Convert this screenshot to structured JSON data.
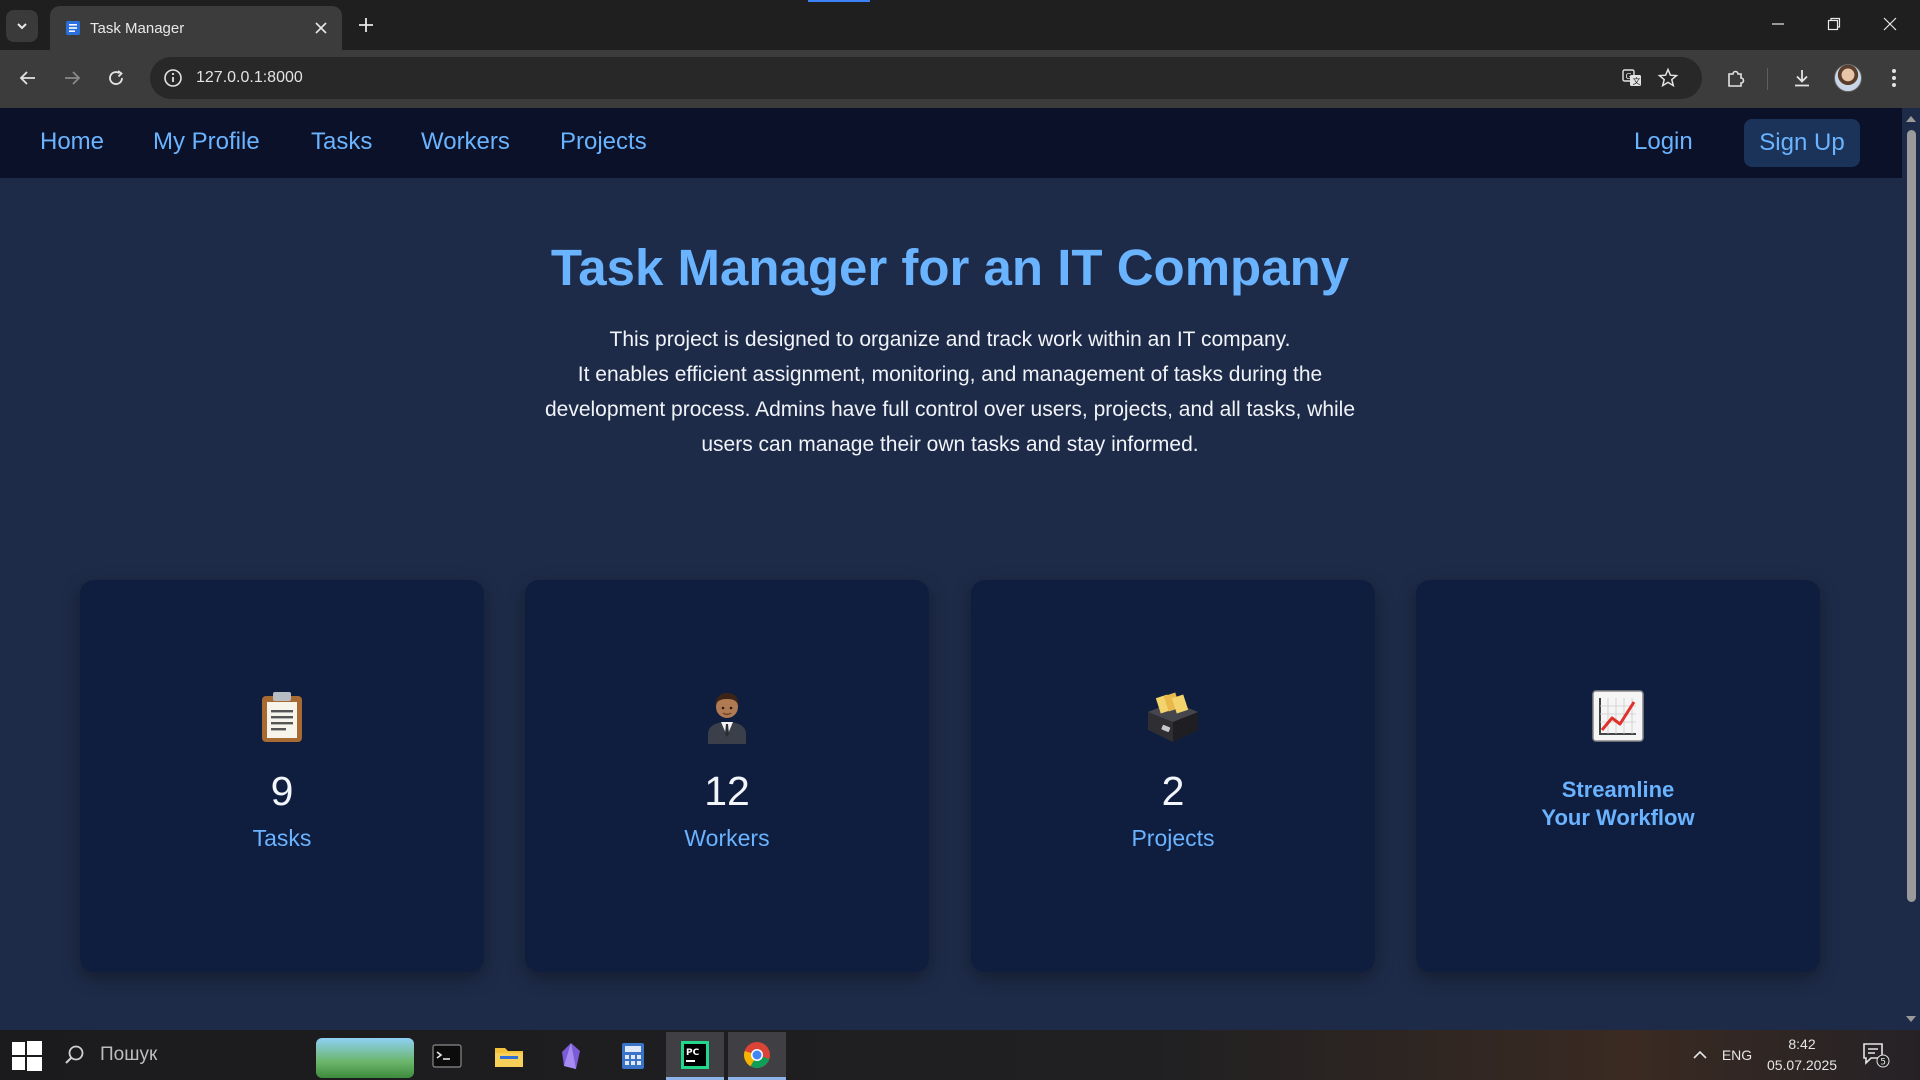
{
  "browser": {
    "tab_title": "Task Manager",
    "url": "127.0.0.1:8000"
  },
  "nav": {
    "links": [
      "Home",
      "My Profile",
      "Tasks",
      "Workers",
      "Projects"
    ],
    "login": "Login",
    "signup": "Sign Up"
  },
  "hero": {
    "title": "Task Manager for an IT Company",
    "line1": "This project is designed to organize and track work within an IT company.",
    "line2": "It enables efficient assignment, monitoring, and management of tasks during the development process. Admins have full control over users, projects, and all tasks, while users can manage their own tasks and stay informed."
  },
  "stats": [
    {
      "value": "9",
      "label": "Tasks",
      "icon": "clipboard-icon"
    },
    {
      "value": "12",
      "label": "Workers",
      "icon": "worker-icon"
    },
    {
      "value": "2",
      "label": "Projects",
      "icon": "card-file-box-icon"
    }
  ],
  "cta": {
    "line1": "Streamline",
    "line2": "Your Workflow",
    "icon": "chart-increasing-icon"
  },
  "taskbar": {
    "search_placeholder": "Пошук",
    "language": "ENG",
    "time": "8:42",
    "date": "05.07.2025",
    "notifications": "5"
  },
  "colors": {
    "accent": "#6ab3ff",
    "navbar_bg": "#0a1128",
    "page_bg": "#1e2b48",
    "card_bg": "#0f1d3f"
  }
}
